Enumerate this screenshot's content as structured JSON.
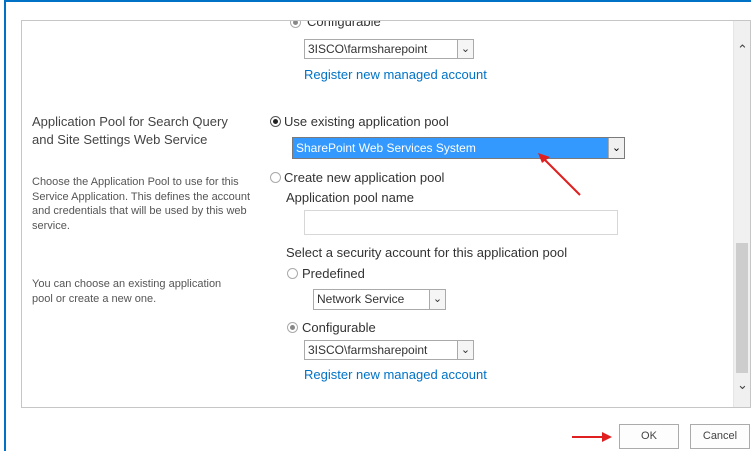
{
  "top": {
    "configurable_label": "Configurable",
    "account_value": "3ISCO\\farmsharepoint",
    "register_link": "Register new managed account"
  },
  "section": {
    "title": "Application Pool for Search Query and Site Settings Web Service",
    "desc1": "Choose the Application Pool to use for this Service Application.  This defines the account and credentials that will be used by this web service.",
    "desc2": "You can choose an existing application pool or create a new one."
  },
  "pool": {
    "use_existing_label": "Use existing application pool",
    "existing_selected": "SharePoint Web Services System",
    "create_new_label": "Create new application pool",
    "pool_name_label": "Application pool name",
    "pool_name_value": "",
    "security_label": "Select a security account for this application pool",
    "predefined_label": "Predefined",
    "predefined_value": "Network Service",
    "configurable_label": "Configurable",
    "configurable_value": "3ISCO\\farmsharepoint",
    "register_link": "Register new managed account"
  },
  "buttons": {
    "ok": "OK",
    "cancel": "Cancel"
  },
  "icons": {
    "dropdown": "chevron-down-icon",
    "scroll_up": "chevron-up-icon",
    "scroll_down": "chevron-down-icon",
    "annotation": "red-arrow-icon"
  },
  "colors": {
    "accent": "#0072c6",
    "selection": "#3399ff",
    "annotation": "#e02020"
  }
}
